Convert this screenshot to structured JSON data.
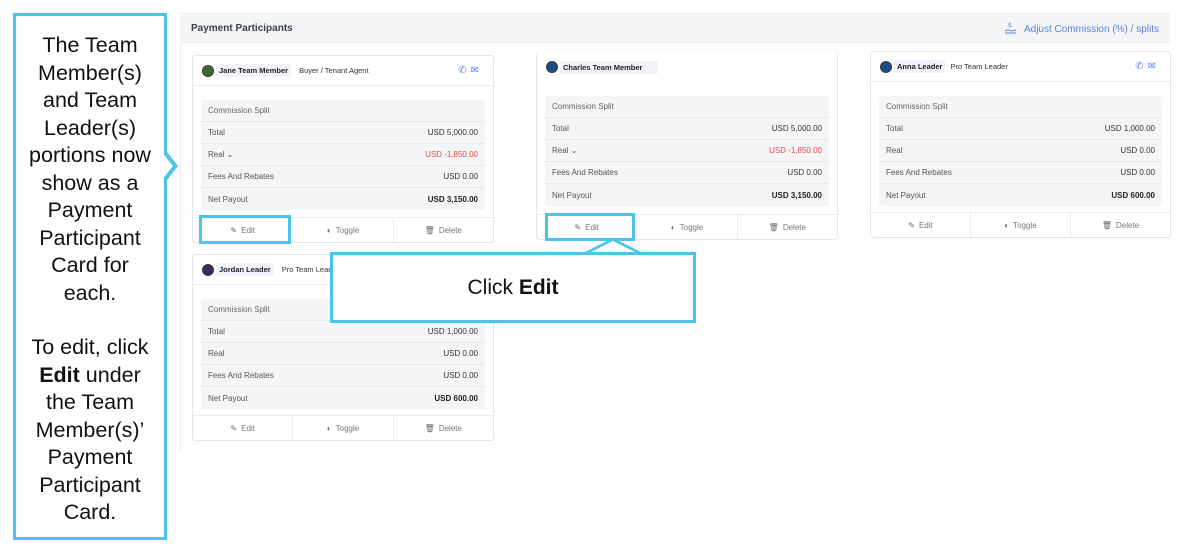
{
  "sidebar_callout": {
    "lines_part1": [
      "The Team",
      "Member(s)",
      "and Team",
      "Leader(s)",
      "portions now",
      "show as a",
      "Payment",
      "Participant",
      "Card for",
      "each."
    ],
    "line_edit_prefix": "To edit, click",
    "edit_word": "Edit",
    "edit_suffix": "under",
    "lines_part2": [
      "the Team",
      "Member(s)’",
      "Payment",
      "Participant",
      "Card."
    ]
  },
  "panel": {
    "title": "Payment Participants",
    "adjust_link": "Adjust Commission (%) / splits"
  },
  "click_callout": {
    "prefix": "Click",
    "bold": "Edit"
  },
  "labels": {
    "commission_split": "Commission Split",
    "total": "Total",
    "real": "Real",
    "real_dropdown": "Real ⌄",
    "fees": "Fees And Rebates",
    "net_payout": "Net Payout",
    "edit": "Edit",
    "toggle": "Toggle",
    "delete": "Delete"
  },
  "cards": [
    {
      "name": "Jane Team Member",
      "role": "Buyer / Tenant Agent",
      "avatar_color": "#3d6b2f",
      "total": "USD 5,000.00",
      "real": "USD -1,850.00",
      "fees": "USD 0.00",
      "net": "USD 3,150.00"
    },
    {
      "name": "Jordan Leader",
      "role": "Pro Team Leader",
      "avatar_color": "#3a2a5c",
      "total": "USD 1,000.00",
      "real": "USD 0.00",
      "fees": "USD 0.00",
      "net": "USD 600.00"
    },
    {
      "name": "Charles Team Member",
      "role": "",
      "avatar_color": "#1d4e89",
      "total": "USD 5,000.00",
      "real": "USD -1,850.00",
      "fees": "USD 0.00",
      "net": "USD 3,150.00"
    },
    {
      "name": "Anna Leader",
      "role": "Pro Team Leader",
      "avatar_color": "#1d4e89",
      "total": "USD 1,000.00",
      "real": "USD 0.00",
      "fees": "USD 0.00",
      "net": "USD 600.00"
    }
  ],
  "colors": {
    "highlight": "#4cc3e8",
    "link": "#5c7fe6",
    "negative": "#e5484d"
  }
}
